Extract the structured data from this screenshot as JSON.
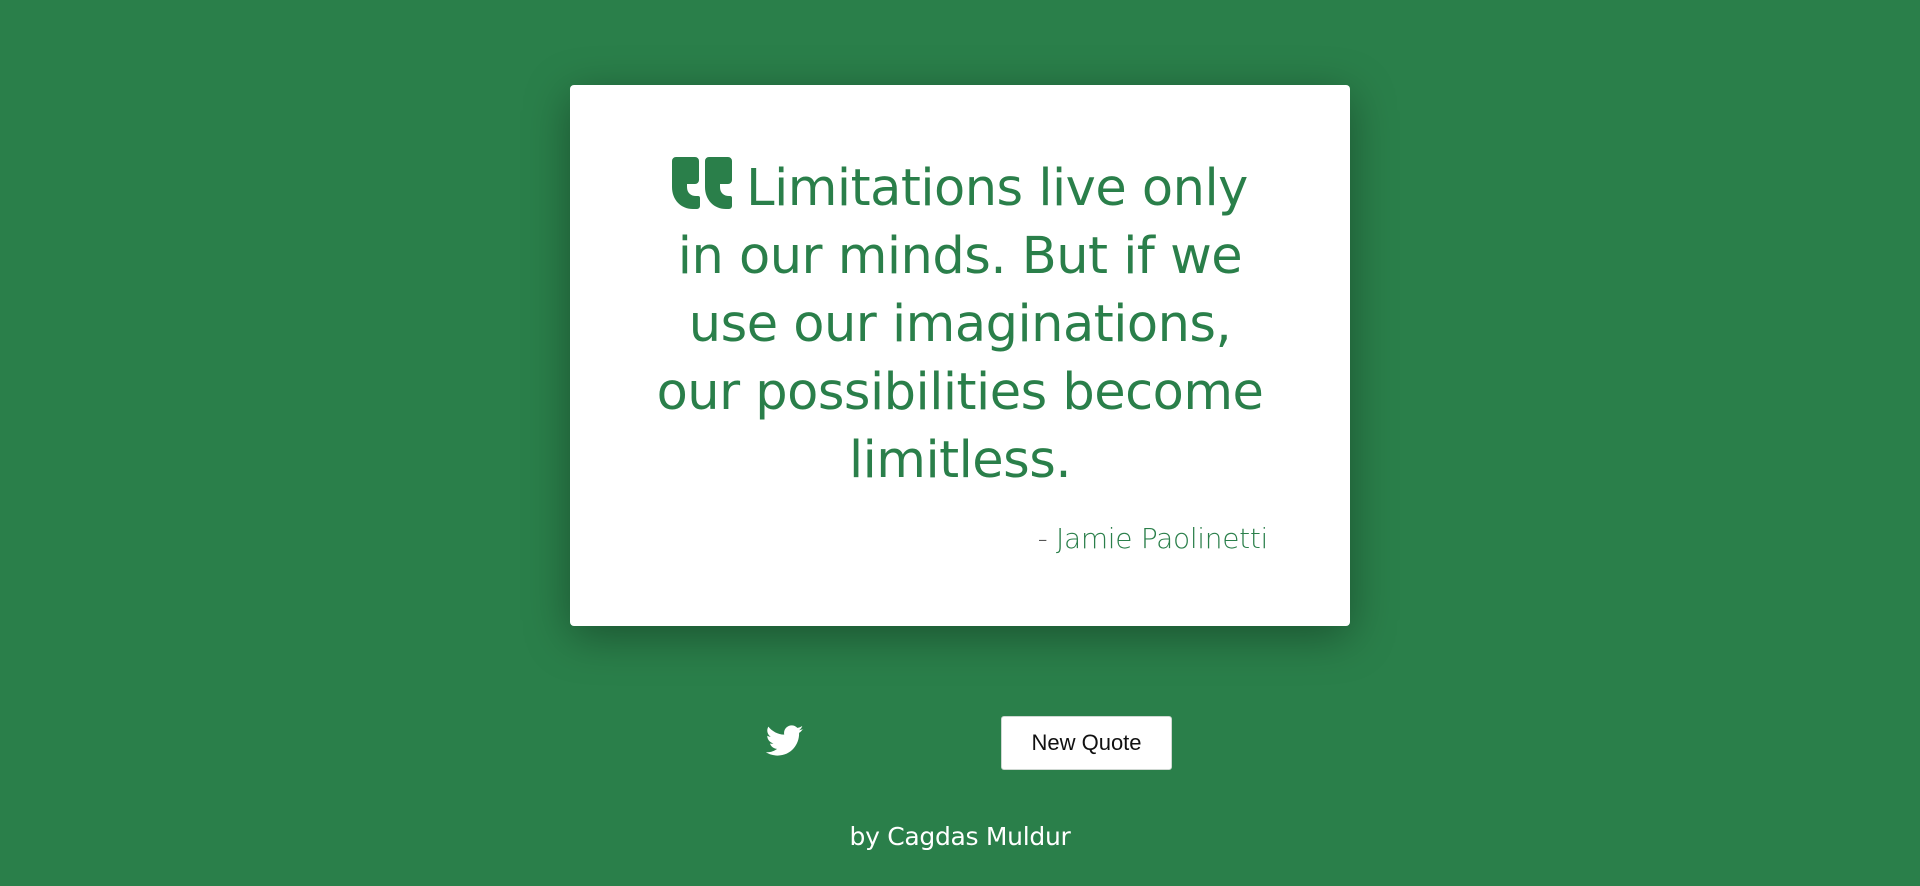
{
  "colors": {
    "background": "#2a7f4a",
    "card": "#ffffff",
    "accent": "#2a7f4a"
  },
  "quote": {
    "icon": "quote-left-icon",
    "text": "Limitations live only in our minds. But if we use our imaginations, our possibilities become limitless.",
    "author_prefix": "-",
    "author": "Jamie Paolinetti"
  },
  "actions": {
    "tweet_icon": "twitter-icon",
    "new_quote_label": "New Quote"
  },
  "footer": {
    "credit": "by Cagdas Muldur"
  }
}
